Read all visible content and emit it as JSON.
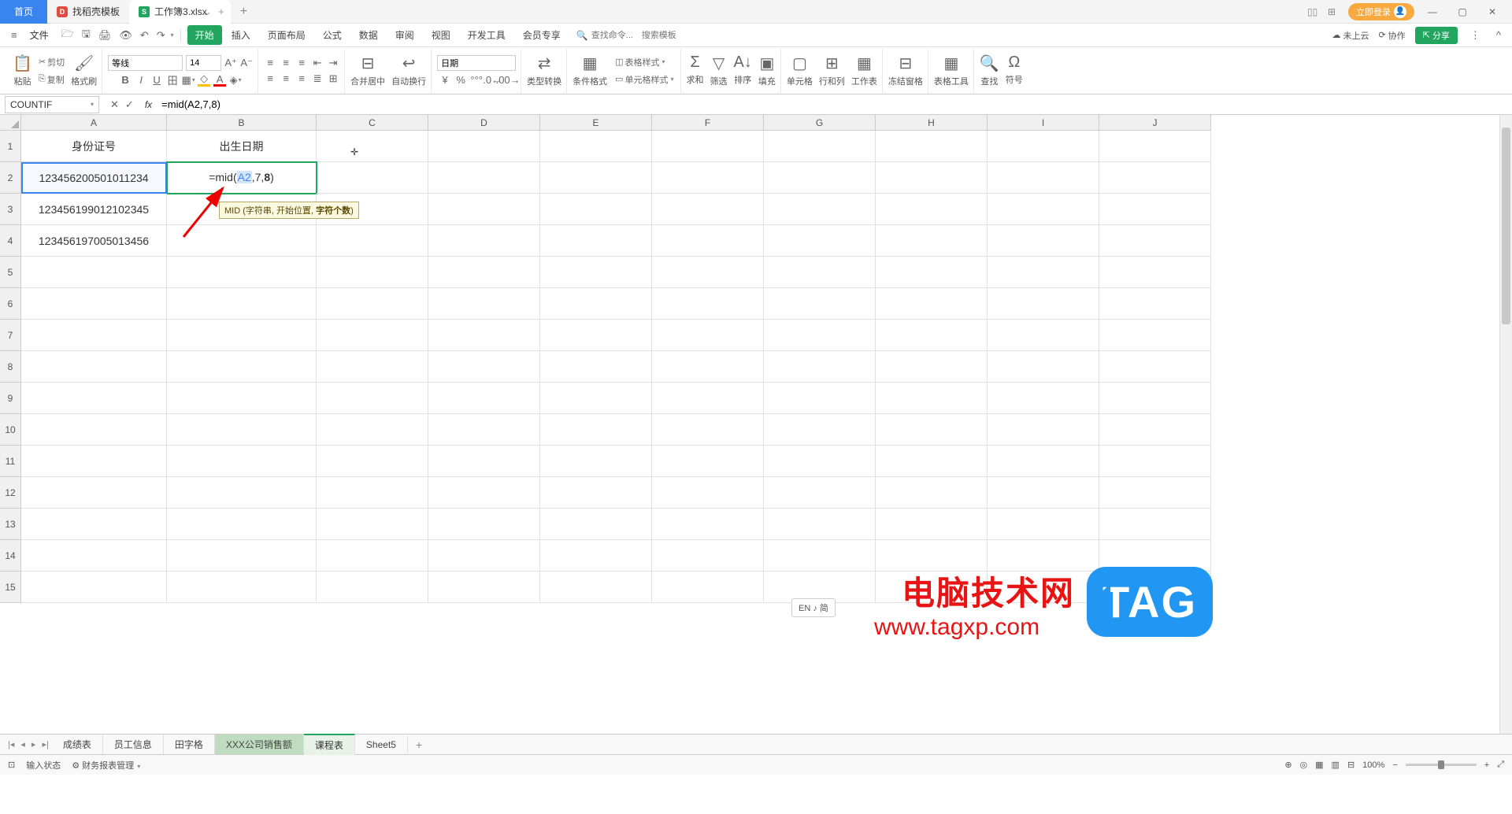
{
  "titlebar": {
    "home": "首页",
    "tab1": "找稻壳模板",
    "tab2": "工作簿3.xlsx",
    "login": "立即登录"
  },
  "menubar": {
    "file": "文件",
    "tabs": [
      "开始",
      "插入",
      "页面布局",
      "公式",
      "数据",
      "审阅",
      "视图",
      "开发工具",
      "会员专享"
    ],
    "search_cmd": "查找命令...",
    "search_tpl": "搜索模板",
    "not_cloud": "未上云",
    "collab": "协作",
    "share": "分享"
  },
  "toolbar": {
    "paste": "粘贴",
    "cut": "剪切",
    "copy": "复制",
    "format_painter": "格式刷",
    "font": "等线",
    "font_size": "14",
    "merge_center": "合并居中",
    "auto_wrap": "自动换行",
    "number_fmt": "日期",
    "type_convert": "类型转换",
    "cond_format": "条件格式",
    "table_style": "表格样式",
    "cell_style": "单元格样式",
    "sum": "求和",
    "filter": "筛选",
    "sort": "排序",
    "fill": "填充",
    "cell": "单元格",
    "rowcol": "行和列",
    "worksheet": "工作表",
    "freeze": "冻结窗格",
    "table_tools": "表格工具",
    "find": "查找",
    "symbols": "符号"
  },
  "formula_bar": {
    "cell_name": "COUNTIF",
    "formula": "=mid(A2,7,8)"
  },
  "columns": [
    "A",
    "B",
    "C",
    "D",
    "E",
    "F",
    "G",
    "H",
    "I",
    "J"
  ],
  "rows": [
    "1",
    "2",
    "3",
    "4",
    "5",
    "6",
    "7",
    "8",
    "9",
    "10",
    "11",
    "12",
    "13",
    "14",
    "15"
  ],
  "cells": {
    "A1": "身份证号",
    "B1": "出生日期",
    "A2": "123456200501011234",
    "A3": "123456199012102345",
    "A4": "123456197005013456",
    "B2_prefix": "=mid(",
    "B2_ref": "A2",
    "B2_mid": ",7,",
    "B2_last": "8",
    "B2_end": ")"
  },
  "tooltip": {
    "fn": "MID",
    "open": " (字符串, 开始位置, ",
    "bold": "字符个数",
    "close": ")"
  },
  "sheet_tabs": [
    "成绩表",
    "员工信息",
    "田字格",
    "XXX公司销售额",
    "课程表",
    "Sheet5"
  ],
  "status": {
    "input_mode": "输入状态",
    "fin_report": "财务报表管理",
    "zoom": "100%"
  },
  "ime": "EN ♪ 简",
  "watermark": {
    "title": "电脑技术网",
    "url": "www.tagxp.com",
    "tag": "TAG"
  }
}
